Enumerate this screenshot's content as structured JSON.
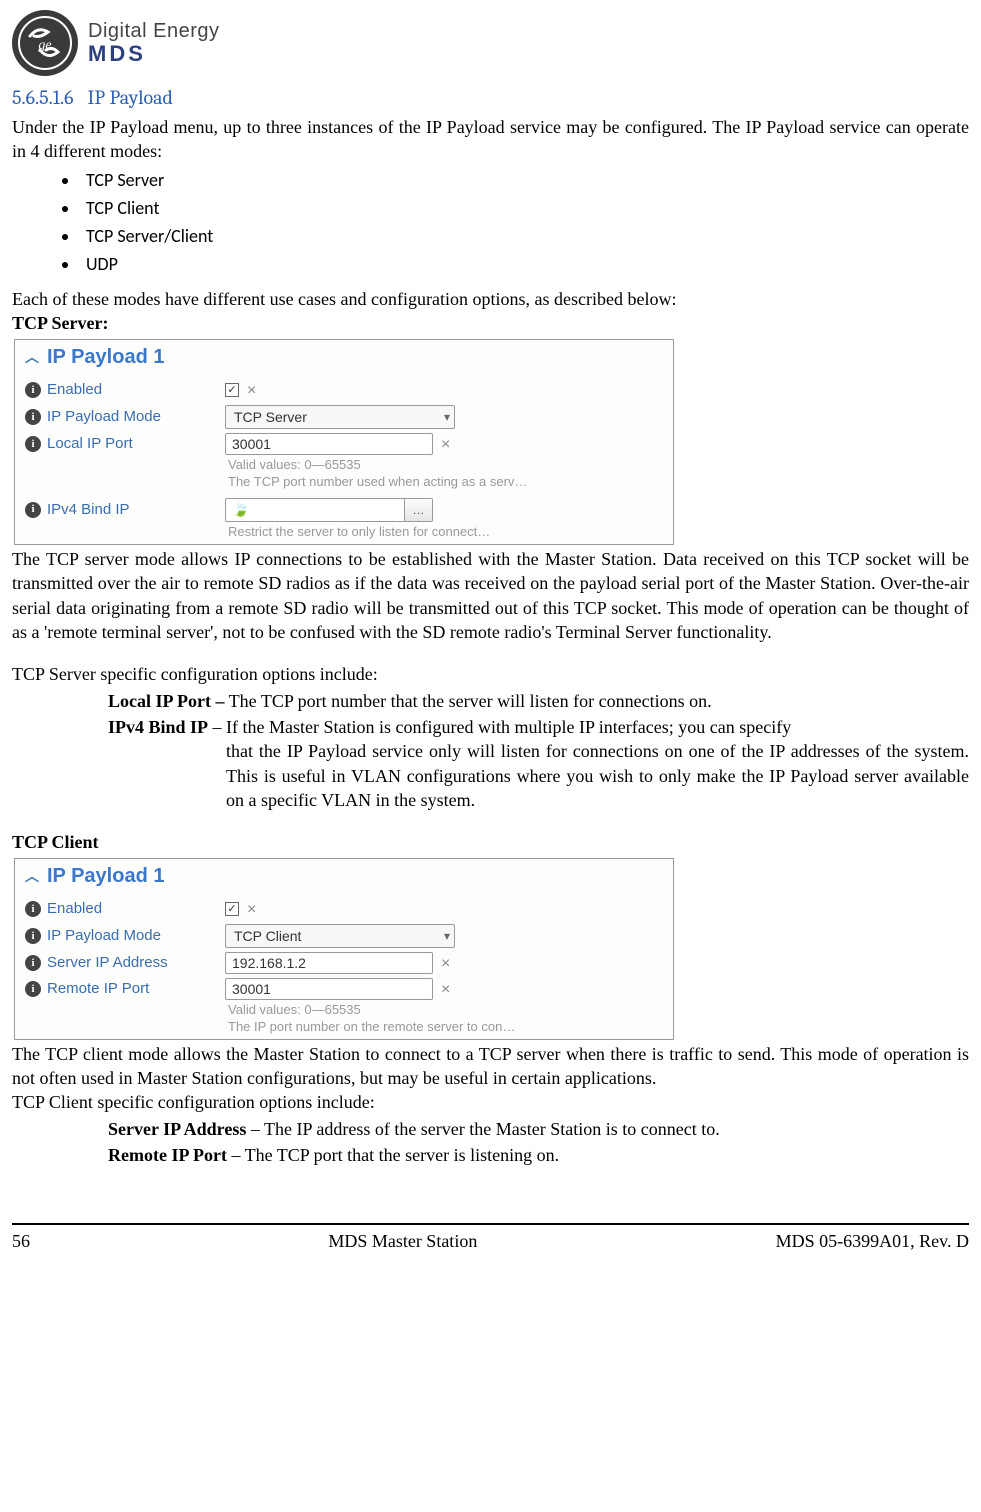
{
  "logo": {
    "brand": "Digital Energy",
    "sub": "MDS"
  },
  "section": {
    "number": "5.6.5.1.6",
    "title": "IP Payload"
  },
  "intro": "Under the IP Payload menu, up to three instances of the IP Payload service may be configured. The IP Payload service can operate in 4 different modes:",
  "modes": [
    "TCP Server",
    "TCP Client",
    "TCP Server/Client",
    "UDP"
  ],
  "modes_note": "Each of these modes have different use cases and configuration options, as described below:",
  "tcp_server": {
    "heading": "TCP Server:",
    "panel": {
      "title": "IP Payload 1",
      "rows": {
        "enabled_label": "Enabled",
        "mode_label": "IP Payload Mode",
        "mode_value": "TCP Server",
        "port_label": "Local IP Port",
        "port_value": "30001",
        "port_hint1": "Valid values: 0—65535",
        "port_hint2": "The TCP port number used when acting as a serv…",
        "bind_label": "IPv4 Bind IP",
        "bind_hint": "Restrict the server to only listen for connect…"
      }
    },
    "desc": "The TCP server mode allows IP connections to be established with the Master Station. Data received on this TCP socket will be transmitted over the air to remote SD radios as if the data was received on the payload serial port of the Master Station. Over-the-air serial data originating from a remote SD radio will be transmitted out of this TCP socket. This mode of operation can be thought of as a 'remote terminal server', not to be confused with the SD remote radio's Terminal Server functionality.",
    "options_intro": "TCP Server specific configuration options include:",
    "opt1_label": "Local IP Port –",
    "opt1_desc": "The TCP port number that the server will listen for connections on.",
    "opt2_label": "IPv4 Bind IP",
    "opt2_dash": "–",
    "opt2_desc_first": "If the Master Station is configured with multiple IP interfaces; you can specify",
    "opt2_desc_rest": "that the IP Payload service only will listen for connections on one of the IP addresses of the system. This is useful in VLAN configurations where you wish to only make the IP Payload server available on a specific VLAN in the system."
  },
  "tcp_client": {
    "heading": "TCP Client",
    "panel": {
      "title": "IP Payload 1",
      "rows": {
        "enabled_label": "Enabled",
        "mode_label": "IP Payload Mode",
        "mode_value": "TCP Client",
        "server_label": "Server IP Address",
        "server_value": "192.168.1.2",
        "port_label": "Remote IP Port",
        "port_value": "30001",
        "port_hint1": "Valid values: 0—65535",
        "port_hint2": "The IP port number on the remote server to con…"
      }
    },
    "desc": "The TCP client mode allows the Master Station to connect to a TCP server when there is traffic to send. This mode of operation is not often used in Master Station configurations, but may be useful in certain applications.",
    "options_intro": "TCP Client specific configuration options include:",
    "opt1_label": "Server IP Address",
    "opt1_desc": "– The IP address of the server the Master Station is to connect to.",
    "opt2_label": "Remote IP Port",
    "opt2_desc": "– The TCP port that the server is listening on."
  },
  "footer": {
    "page": "56",
    "center": "MDS Master Station",
    "right": "MDS 05-6399A01, Rev. D"
  }
}
